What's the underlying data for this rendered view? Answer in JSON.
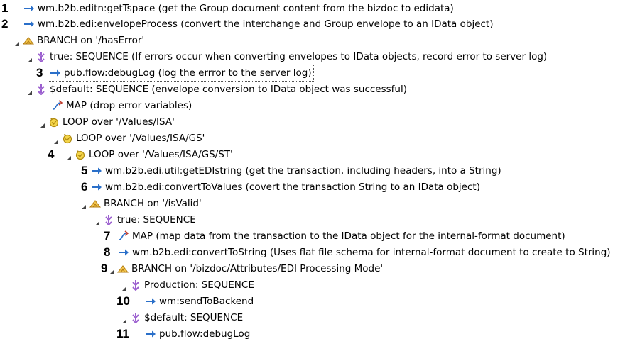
{
  "tree": [
    {
      "num": "1",
      "icon": "invoke-arrow-icon",
      "label": "wm.b2b.editn:getTspace (get the Group document content from the bizdoc to edidata)"
    },
    {
      "num": "2",
      "icon": "invoke-arrow-icon",
      "label": "wm.b2b.edi:envelopeProcess (convert the interchange and Group envelope to an IData object)"
    },
    {
      "num": "",
      "icon": "branch-icon",
      "label": "BRANCH on '/hasError'"
    },
    {
      "num": "",
      "icon": "sequence-icon",
      "label": "true: SEQUENCE (If errors occur when converting envelopes to IData objects, record error to server log)"
    },
    {
      "num": "3",
      "icon": "invoke-arrow-icon",
      "label": "pub.flow:debugLog (log the errror to the server log)"
    },
    {
      "num": "",
      "icon": "sequence-icon",
      "label": "$default: SEQUENCE (envelope conversion to IData object was successful)"
    },
    {
      "num": "",
      "icon": "map-icon",
      "label": "MAP (drop error variables)"
    },
    {
      "num": "",
      "icon": "loop-icon",
      "label": "LOOP over '/Values/ISA'"
    },
    {
      "num": "",
      "icon": "loop-icon",
      "label": "LOOP over '/Values/ISA/GS'"
    },
    {
      "num": "4",
      "icon": "loop-icon",
      "label": "LOOP over '/Values/ISA/GS/ST'"
    },
    {
      "num": "5",
      "icon": "invoke-arrow-icon",
      "label": "wm.b2b.edi.util:getEDIstring (get the transaction, including headers, into a String)"
    },
    {
      "num": "6",
      "icon": "invoke-arrow-icon",
      "label": "wm.b2b.edi:convertToValues (covert the transaction String to an IData object)"
    },
    {
      "num": "",
      "icon": "branch-icon",
      "label": "BRANCH on '/isValid'"
    },
    {
      "num": "",
      "icon": "sequence-icon",
      "label": "true: SEQUENCE"
    },
    {
      "num": "7",
      "icon": "map-icon",
      "label": "MAP (map data from the transaction to the IData object for the internal-format document)"
    },
    {
      "num": "8",
      "icon": "invoke-arrow-icon",
      "label": "wm.b2b.edi:convertToString (Uses flat file schema for internal-format document to create to String)"
    },
    {
      "num": "9",
      "icon": "branch-icon",
      "label": "BRANCH on '/bizdoc/Attributes/EDI Processing Mode'"
    },
    {
      "num": "",
      "icon": "sequence-icon",
      "label": "Production: SEQUENCE"
    },
    {
      "num": "10",
      "icon": "invoke-arrow-icon",
      "label": "wm:sendToBackend"
    },
    {
      "num": "",
      "icon": "sequence-icon",
      "label": "$default: SEQUENCE"
    },
    {
      "num": "11",
      "icon": "invoke-arrow-icon",
      "label": "pub.flow:debugLog"
    }
  ]
}
